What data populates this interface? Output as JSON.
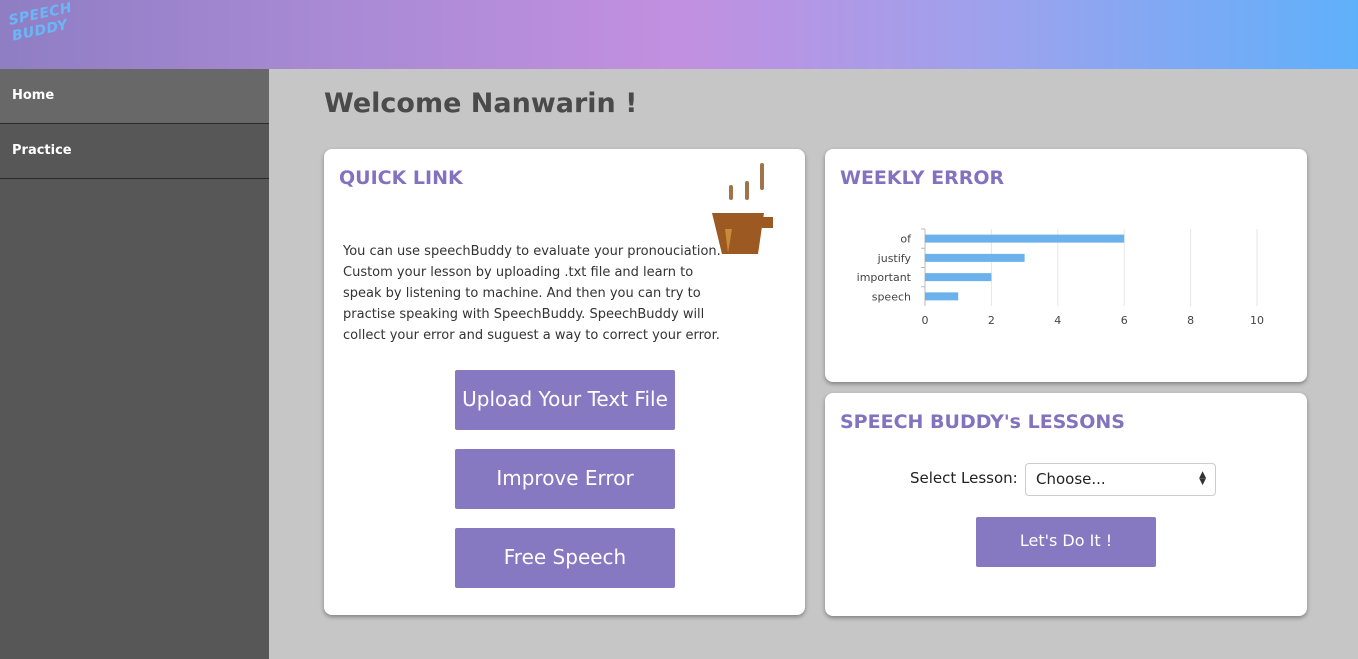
{
  "logo": {
    "line1": "SPEECH",
    "line2": "BUDDY"
  },
  "sidebar": {
    "items": [
      {
        "label": "Home"
      },
      {
        "label": "Practice"
      }
    ]
  },
  "welcome": "Welcome Nanwarin !",
  "quick_link": {
    "title": "QUICK LINK",
    "description": "You can use speechBuddy to evaluate your pronouciation. Custom your lesson by uploading .txt file and learn to speak by listening to machine. And then you can try to practise speaking with SpeechBuddy. SpeechBuddy will collect your error and suguest a way to correct your error.",
    "buttons": [
      "Upload Your Text File",
      "Improve Error",
      "Free Speech"
    ]
  },
  "weekly_error": {
    "title": "WEEKLY ERROR"
  },
  "chart_data": {
    "type": "bar",
    "orientation": "horizontal",
    "categories": [
      "of",
      "justify",
      "important",
      "speech"
    ],
    "values": [
      6,
      3,
      2,
      1
    ],
    "xlim": [
      0,
      10
    ],
    "xticks": [
      0,
      2,
      4,
      6,
      8,
      10
    ],
    "color": "#6bb1ec",
    "grid": true
  },
  "lessons": {
    "title": "SPEECH BUDDY's LESSONS",
    "select_label": "Select Lesson:",
    "select_value": "Choose...",
    "button": "Let's Do It !"
  },
  "colors": {
    "accent": "#8679c2",
    "title": "#8273bf",
    "bar": "#6bb1ec",
    "sidebar": "#575757"
  }
}
